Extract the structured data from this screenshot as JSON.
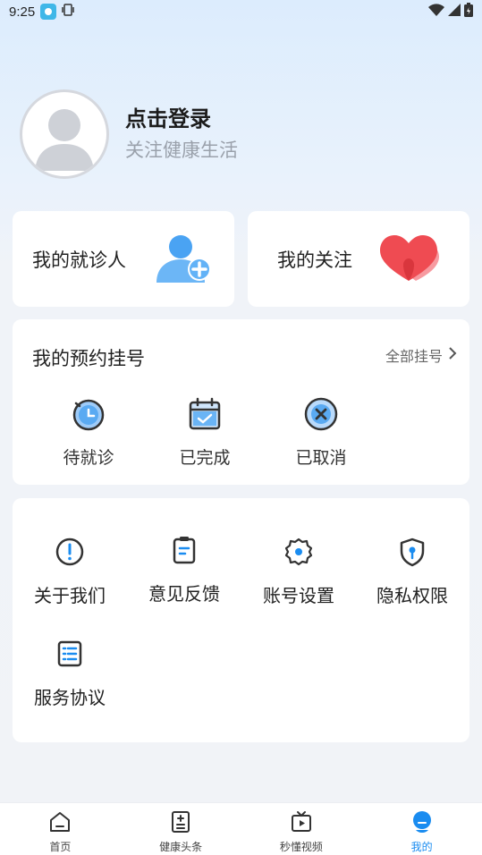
{
  "status_bar": {
    "time": "9:25"
  },
  "profile": {
    "title": "点击登录",
    "subtitle": "关注健康生活"
  },
  "quick": [
    {
      "label": "我的就诊人",
      "icon": "add-patient-icon"
    },
    {
      "label": "我的关注",
      "icon": "hearts-icon"
    }
  ],
  "appointments": {
    "title": "我的预约挂号",
    "all_label": "全部挂号",
    "items": [
      {
        "label": "待就诊",
        "icon": "clock-icon"
      },
      {
        "label": "已完成",
        "icon": "calendar-check-icon"
      },
      {
        "label": "已取消",
        "icon": "cancel-circle-icon"
      }
    ]
  },
  "menu": [
    {
      "label": "关于我们",
      "icon": "info-icon"
    },
    {
      "label": "意见反馈",
      "icon": "clipboard-icon"
    },
    {
      "label": "账号设置",
      "icon": "gear-icon"
    },
    {
      "label": "隐私权限",
      "icon": "shield-icon"
    },
    {
      "label": "服务协议",
      "icon": "document-list-icon"
    }
  ],
  "tabs": [
    {
      "label": "首页",
      "icon": "home-icon"
    },
    {
      "label": "健康头条",
      "icon": "news-icon"
    },
    {
      "label": "秒懂视频",
      "icon": "tv-icon"
    },
    {
      "label": "我的",
      "icon": "profile-icon"
    }
  ],
  "colors": {
    "accent": "#1a8cf0",
    "heart": "#f0474e",
    "person": "#4aa3f3"
  }
}
